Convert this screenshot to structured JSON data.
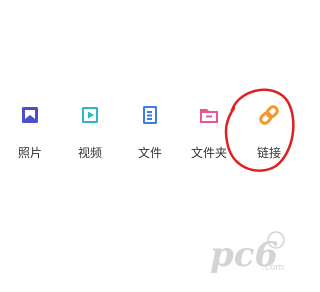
{
  "share": {
    "items": [
      {
        "label": "照片",
        "icon": "photo-icon",
        "color": "#4b4fc9"
      },
      {
        "label": "视频",
        "icon": "video-icon",
        "color": "#2fb6c8"
      },
      {
        "label": "文件",
        "icon": "file-icon",
        "color": "#3d7be8"
      },
      {
        "label": "文件夹",
        "icon": "folder-icon",
        "color": "#e8559a"
      },
      {
        "label": "链接",
        "icon": "link-icon",
        "color": "#f39a2a"
      }
    ]
  },
  "annotation": {
    "color": "#e02020"
  },
  "watermark": {
    "text": "pc6.com"
  }
}
